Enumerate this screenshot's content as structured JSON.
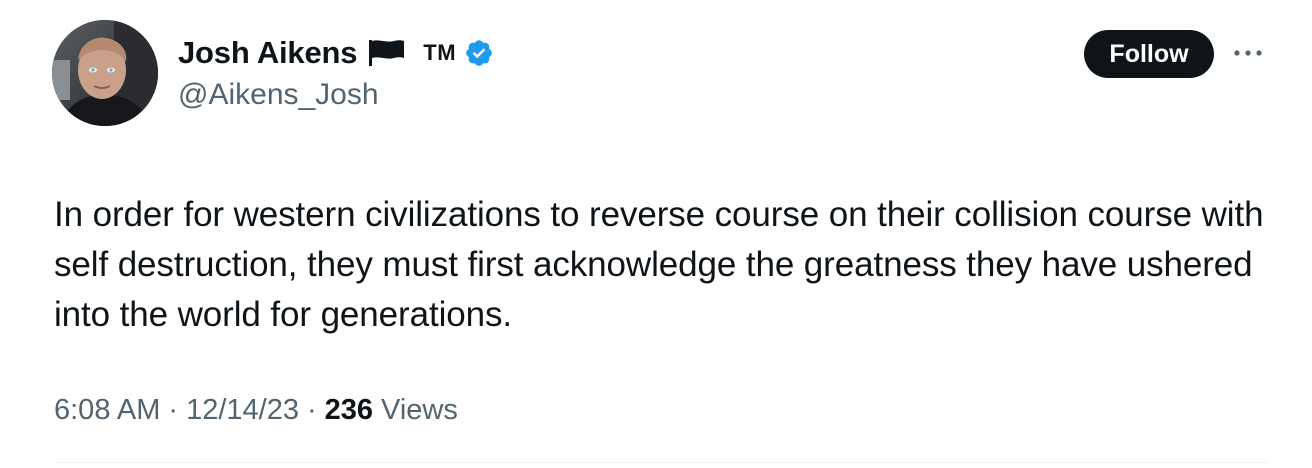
{
  "author": {
    "display_name": "Josh Aikens",
    "flag_icon": "black-flag-icon",
    "tm_mark": "TM",
    "verified_icon": "verified-badge-icon",
    "verified_color": "#1d9bf0",
    "handle": "@Aikens_Josh"
  },
  "actions": {
    "follow_label": "Follow",
    "more_icon": "more-horizontal-icon"
  },
  "tweet": {
    "text": "In order for western civilizations to reverse course on their collision course with self destruction, they must first acknowledge the greatness they have ushered into the world for generations."
  },
  "meta": {
    "time": "6:08 AM",
    "separator": "·",
    "date": "12/14/23",
    "views_count": "236",
    "views_label": "Views"
  },
  "colors": {
    "text_primary": "#0f1419",
    "text_secondary": "#536471",
    "follow_bg": "#0f1419",
    "follow_text": "#ffffff"
  }
}
